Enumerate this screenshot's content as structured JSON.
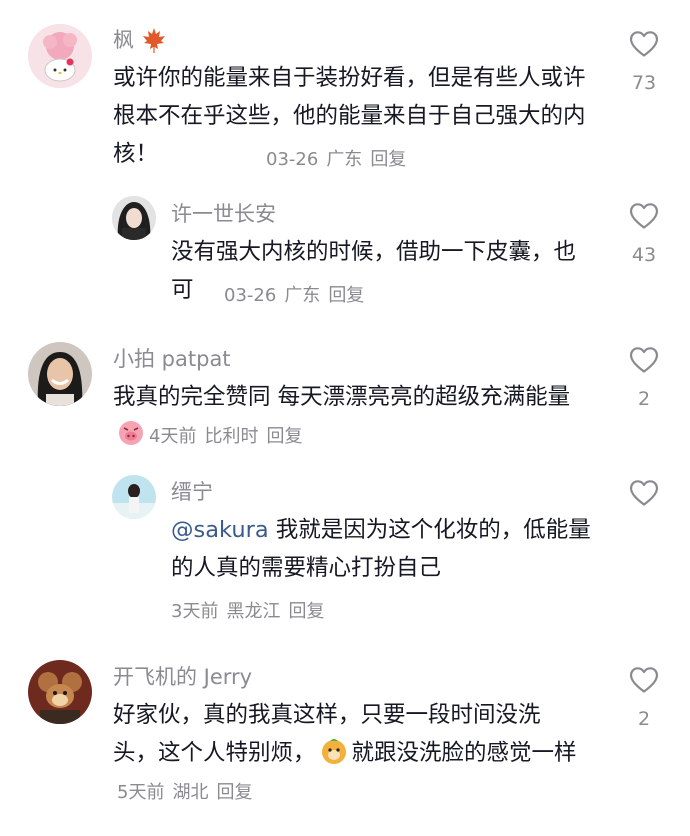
{
  "comments": [
    {
      "username": "枫",
      "username_icon": "maple-leaf-icon",
      "text": "或许你的能量来自于装扮好看，但是有些人或许根本不在乎这些，他的能量来自于自己强大的内核！",
      "date": "03-26",
      "location": "广东",
      "reply_label": "回复",
      "like_count": "73",
      "avatar": "hello-kitty-sakura-avatar"
    },
    {
      "username": "许一世长安",
      "text": "没有强大内核的时候，借助一下皮囊，也可",
      "date": "03-26",
      "location": "广东",
      "reply_label": "回复",
      "like_count": "43",
      "avatar": "dark-hair-avatar"
    },
    {
      "username": "小拍 patpat",
      "text_main": "我真的完全赞同  每天漂漂亮亮的超级充满能量",
      "text_emoji": "pig-face-emoji",
      "date": "4天前",
      "location": "比利时",
      "reply_label": "回复",
      "like_count": "2",
      "avatar": "smiling-woman-avatar"
    },
    {
      "username": "缙宁",
      "mention": "@sakura",
      "text": " 我就是因为这个化妆的，低能量的人真的需要精心打扮自己",
      "date": "3天前",
      "location": "黑龙江",
      "reply_label": "回复",
      "like_count": "",
      "avatar": "girl-outdoor-avatar"
    },
    {
      "username": "开飞机的 Jerry",
      "text_before_emoji": "好家伙，真的我真这样，只要一段时间没洗头，这个人特别烦，",
      "text_emoji": "orange-face-emoji",
      "text_after_emoji": "就跟没洗脸的感觉一样",
      "date": "5天前",
      "location": "湖北",
      "reply_label": "回复",
      "like_count": "2",
      "avatar": "jerry-mouse-avatar"
    }
  ],
  "colors": {
    "text": "#161823",
    "secondary": "#8a8b91",
    "mention": "#3b5b8a"
  }
}
